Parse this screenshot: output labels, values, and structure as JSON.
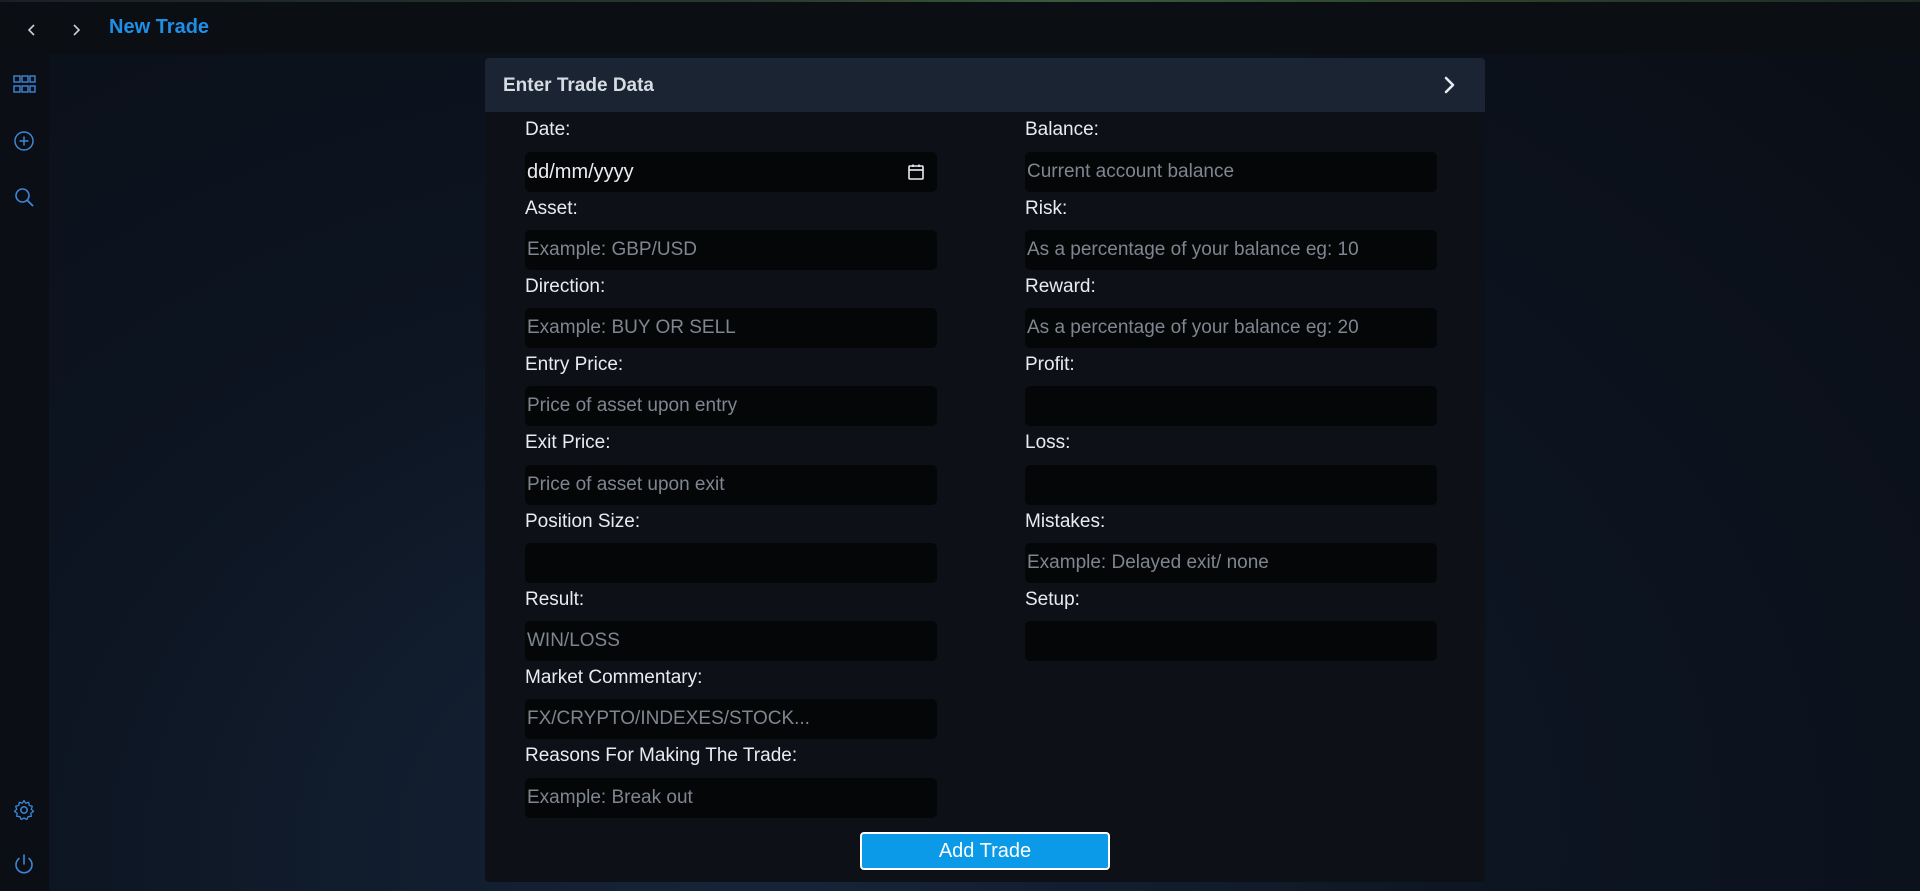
{
  "header": {
    "title": "New Trade"
  },
  "sidebar": {
    "items": [
      {
        "icon": "dashboard-grid-icon"
      },
      {
        "icon": "add-circle-icon"
      },
      {
        "icon": "search-icon"
      },
      {
        "icon": "gear-icon"
      },
      {
        "icon": "power-icon"
      }
    ]
  },
  "panel": {
    "title": "Enter Trade Data"
  },
  "form": {
    "left": [
      {
        "label": "Date:",
        "value": "dd/mm/yyyy",
        "placeholder": ""
      },
      {
        "label": "Asset:",
        "value": "",
        "placeholder": "Example: GBP/USD"
      },
      {
        "label": "Direction:",
        "value": "",
        "placeholder": "Example: BUY OR SELL"
      },
      {
        "label": "Entry Price:",
        "value": "",
        "placeholder": "Price of asset upon entry"
      },
      {
        "label": "Exit Price:",
        "value": "",
        "placeholder": "Price of asset upon exit"
      },
      {
        "label": "Position Size:",
        "value": "",
        "placeholder": ""
      },
      {
        "label": "Result:",
        "value": "",
        "placeholder": "WIN/LOSS"
      },
      {
        "label": "Market Commentary:",
        "value": "",
        "placeholder": "FX/CRYPTO/INDEXES/STOCK..."
      },
      {
        "label": "Reasons For Making The Trade:",
        "value": "",
        "placeholder": "Example: Break out"
      }
    ],
    "right": [
      {
        "label": "Balance:",
        "value": "",
        "placeholder": "Current account balance"
      },
      {
        "label": "Risk:",
        "value": "",
        "placeholder": "As a percentage of your balance eg: 10"
      },
      {
        "label": "Reward:",
        "value": "",
        "placeholder": "As a percentage of your balance eg: 20"
      },
      {
        "label": "Profit:",
        "value": "",
        "placeholder": ""
      },
      {
        "label": "Loss:",
        "value": "",
        "placeholder": ""
      },
      {
        "label": "Mistakes:",
        "value": "",
        "placeholder": "Example: Delayed exit/ none"
      },
      {
        "label": "Setup:",
        "value": "",
        "placeholder": ""
      }
    ],
    "submit_label": "Add Trade"
  },
  "colors": {
    "accent": "#1f8fe6",
    "button": "#0a9ae8",
    "panel_header": "#1a2433",
    "input_bg": "#050608"
  }
}
